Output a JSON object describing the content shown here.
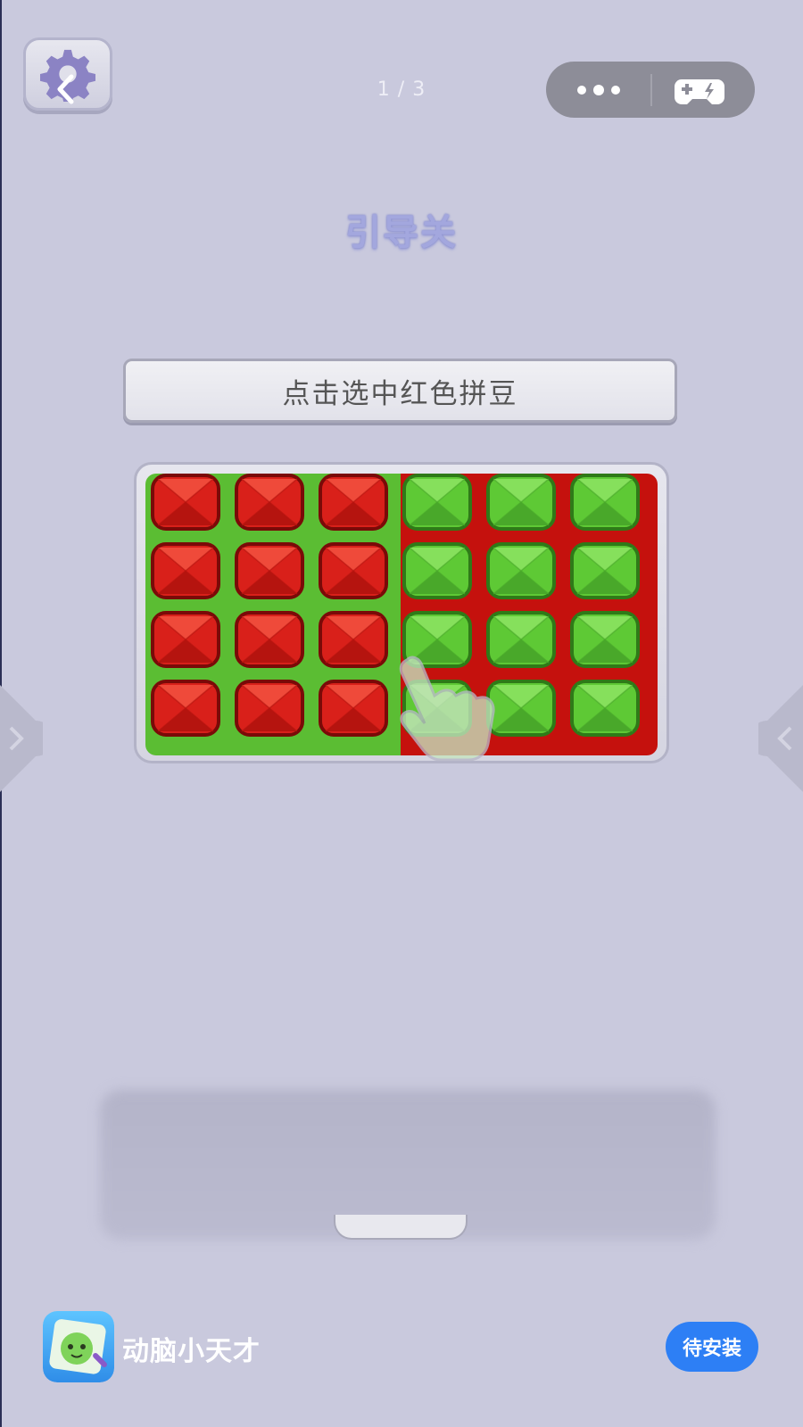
{
  "header": {
    "page_indicator": "1 / 3",
    "settings_icon": "gear-icon",
    "back_icon": "chevron-left-icon",
    "capsule_icons": [
      "more-icon",
      "gamepad-icon"
    ]
  },
  "level": {
    "title": "引导关",
    "instruction": "点击选中红色拼豆"
  },
  "board": {
    "rows": 4,
    "columns": 6,
    "left_half_background": "green",
    "right_half_background": "red",
    "cells": [
      [
        "red",
        "red",
        "red",
        "green",
        "green",
        "green"
      ],
      [
        "red",
        "red",
        "red",
        "green",
        "green",
        "green"
      ],
      [
        "red",
        "red",
        "red",
        "green",
        "green",
        "green"
      ],
      [
        "red",
        "red",
        "red",
        "green",
        "green",
        "green"
      ]
    ],
    "colors": {
      "green_bg": "#5bbd33",
      "red_bg": "#c5110d",
      "red_bean": "#d9201a",
      "green_bean": "#5ec935"
    },
    "tutorial_hand_icon": "hand-pointer-icon"
  },
  "promo": {
    "app_name": "动脑小天才",
    "install_label": "待安装",
    "accent": "#2d7ff5"
  }
}
